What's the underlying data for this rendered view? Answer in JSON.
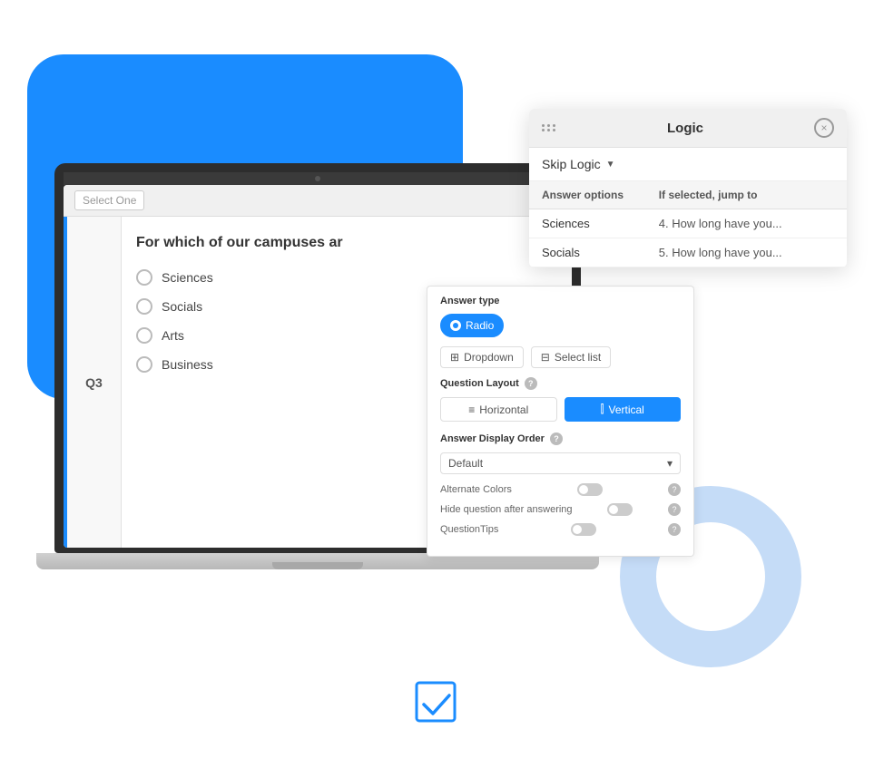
{
  "blue_blob": {},
  "blue_circle": {},
  "laptop": {
    "camera_visible": true,
    "survey": {
      "top_placeholder": "Select One",
      "q_label": "Q3",
      "question_text": "For which of our campuses ar",
      "options": [
        {
          "label": "Sciences"
        },
        {
          "label": "Socials"
        },
        {
          "label": "Arts"
        },
        {
          "label": "Business"
        }
      ]
    }
  },
  "logic_panel": {
    "title": "Logic",
    "close_label": "×",
    "skip_logic_label": "Skip Logic",
    "table": {
      "col1": "Answer options",
      "col2": "If selected, jump to",
      "rows": [
        {
          "answer": "Sciences",
          "jump": "4. How long have you..."
        },
        {
          "answer": "Socials",
          "jump": "5. How long have you..."
        }
      ]
    }
  },
  "settings_panel": {
    "answer_type_label": "Answer type",
    "answer_types": [
      {
        "label": "Radio",
        "active": true,
        "icon": "✓"
      },
      {
        "label": "Dropdown",
        "active": false,
        "icon": "⊞"
      },
      {
        "label": "Select list",
        "active": false,
        "icon": "⊟"
      }
    ],
    "question_layout_label": "Question Layout",
    "layouts": [
      {
        "label": "Horizontal",
        "active": false,
        "icon": "≡"
      },
      {
        "label": "Vertical",
        "active": true,
        "icon": "⫿"
      }
    ],
    "answer_display_label": "Answer Display Order",
    "display_order_value": "Default",
    "toggles": [
      {
        "label": "Alternate Colors",
        "enabled": false
      },
      {
        "label": "Hide question after answering",
        "enabled": false
      },
      {
        "label": "QuestionTips",
        "enabled": false
      }
    ]
  },
  "bottom_icon": {
    "title": "checkmark logo"
  }
}
